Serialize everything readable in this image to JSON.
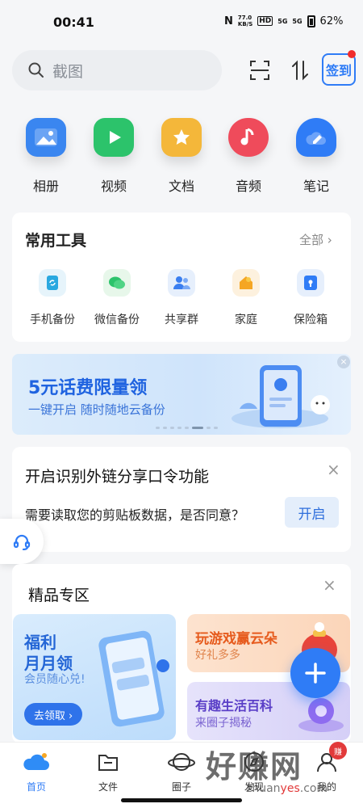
{
  "status_bar": {
    "time": "00:41",
    "nfc": "N",
    "net_speed_value": "77.0",
    "net_speed_unit": "KB/S",
    "hd": "HD",
    "signal1": "5G",
    "signal2": "5G",
    "battery": "62%"
  },
  "search": {
    "placeholder": "截图"
  },
  "header": {
    "sign_in": "签到"
  },
  "quick_access": [
    {
      "label": "相册",
      "icon": "album-icon",
      "color": "#3a86f0"
    },
    {
      "label": "视频",
      "icon": "video-icon",
      "color": "#2cc36b"
    },
    {
      "label": "文档",
      "icon": "document-icon",
      "color": "#f4b73a"
    },
    {
      "label": "音频",
      "icon": "audio-icon",
      "color": "#ef4b5b"
    },
    {
      "label": "笔记",
      "icon": "note-icon",
      "color": "#2f7cf6"
    }
  ],
  "tools": {
    "title": "常用工具",
    "all": "全部",
    "items": [
      {
        "label": "手机备份",
        "icon": "phone-backup-icon"
      },
      {
        "label": "微信备份",
        "icon": "wechat-backup-icon"
      },
      {
        "label": "共享群",
        "icon": "share-group-icon"
      },
      {
        "label": "家庭",
        "icon": "family-icon"
      },
      {
        "label": "保险箱",
        "icon": "safe-icon"
      }
    ]
  },
  "banner": {
    "title": "5元话费限量领",
    "subtitle": "一键开启  随时随地云备份",
    "close": "×"
  },
  "share_prompt": {
    "title": "开启识别外链分享口令功能",
    "description": "需要读取您的剪贴板数据，是否同意？",
    "button": "开启",
    "close": "×"
  },
  "premium": {
    "title": "精品专区",
    "close": "×",
    "card1": {
      "title_line1": "福利",
      "title_line2": "月月领",
      "subtitle": "会员随心兑!",
      "button": "去领取 ›"
    },
    "card2": {
      "title": "玩游戏赢云朵",
      "subtitle": "好礼多多"
    },
    "card3": {
      "title": "有趣生活百科",
      "subtitle": "来圈子揭秘"
    }
  },
  "bottom_nav": [
    {
      "label": "首页",
      "icon": "home-cloud-icon",
      "active": true
    },
    {
      "label": "文件",
      "icon": "folder-icon",
      "active": false
    },
    {
      "label": "圈子",
      "icon": "circle-icon",
      "active": false
    },
    {
      "label": "发现",
      "icon": "discover-icon",
      "active": false
    },
    {
      "label": "我的",
      "icon": "profile-icon",
      "active": false
    }
  ],
  "watermark": {
    "text": "好赚网",
    "url_prefix": "zhuan",
    "url_accent": "yes",
    "url_suffix": ".com",
    "badge": "赚"
  }
}
